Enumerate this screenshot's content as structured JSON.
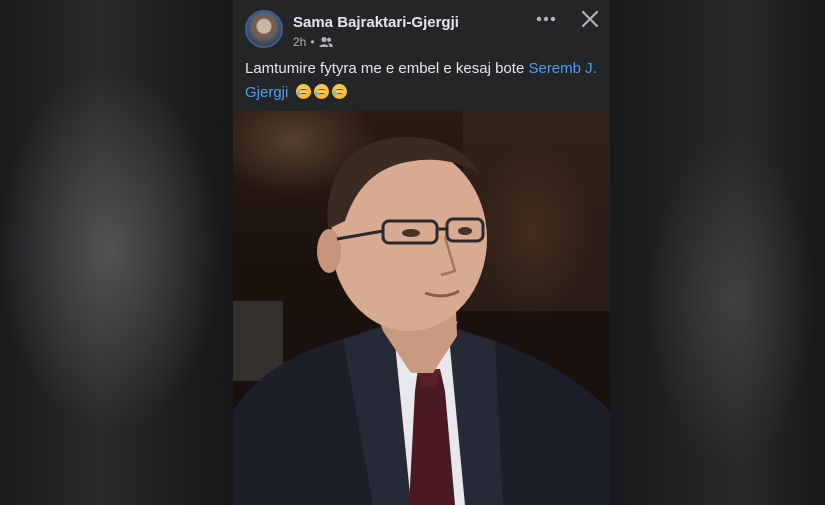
{
  "post": {
    "author_name": "Sama Bajraktari-Gjergji",
    "timestamp": "2h",
    "separator": "•",
    "audience_icon": "friends-icon",
    "text_before_mention": "Lamtumire fytyra me e embel e kesaj bote ",
    "mention": "Seremb J. Gjergji",
    "emojis": [
      "crying-face",
      "crying-face",
      "crying-face"
    ],
    "photo_description_icon": "photo"
  },
  "toolbar": {
    "more_icon": "more-options-icon",
    "close_icon": "close-icon"
  },
  "colors": {
    "card_bg": "#242526",
    "primary_text": "#e4e6eb",
    "secondary_text": "#b0b3b8",
    "link": "#4e9ff5"
  }
}
